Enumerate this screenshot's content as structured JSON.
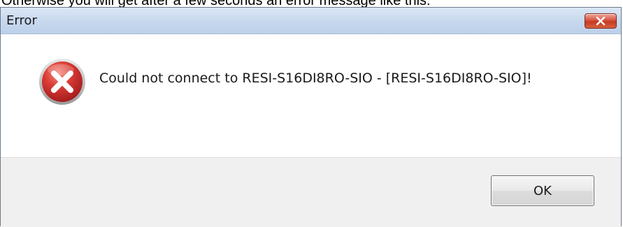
{
  "caption": "Otherwise you will get after a few seconds an error message like this:",
  "dialog": {
    "title": "Error",
    "close_icon": "close-icon",
    "message_icon": "error-icon",
    "message": "Could not connect to RESI-S16DI8RO-SIO - [RESI-S16DI8RO-SIO]!",
    "ok_label": "OK"
  },
  "colors": {
    "close_button": "#c53a22",
    "error_icon": "#c8282a",
    "titlebar": "#c9daef",
    "footer": "#f0f0f0"
  }
}
